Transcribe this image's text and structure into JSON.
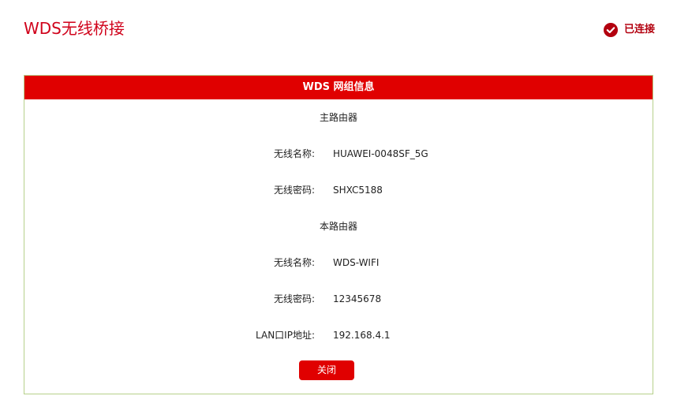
{
  "page": {
    "title": "WDS无线桥接"
  },
  "status": {
    "label": "已连接",
    "icon": "check-circle-icon",
    "color": "#b3000f"
  },
  "panel": {
    "header": "WDS 网组信息",
    "header_color": "#e00000",
    "main_router": {
      "title": "主路由器",
      "ssid_label": "无线名称:",
      "ssid_value": "HUAWEI-0048SF_5G",
      "password_label": "无线密码:",
      "password_value": "SHXC5188"
    },
    "this_router": {
      "title": "本路由器",
      "ssid_label": "无线名称:",
      "ssid_value": "WDS-WIFI",
      "password_label": "无线密码:",
      "password_value": "12345678",
      "lan_ip_label": "LAN口IP地址:",
      "lan_ip_value": "192.168.4.1"
    },
    "close_label": "关闭"
  }
}
